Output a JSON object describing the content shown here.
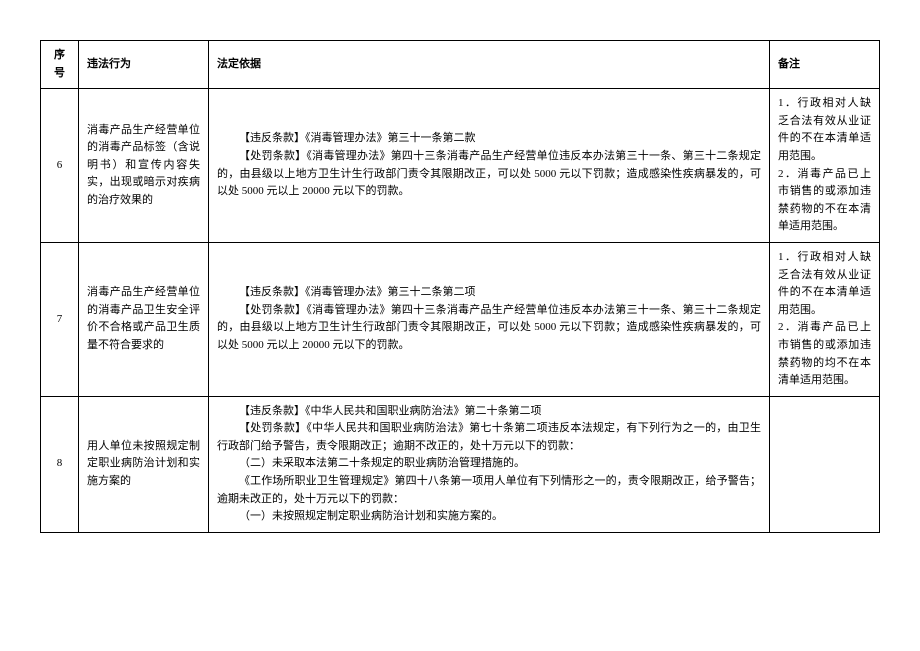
{
  "headers": {
    "num": "序号",
    "action": "违法行为",
    "basis": "法定依据",
    "note": "备注"
  },
  "rows": [
    {
      "num": "6",
      "action": "消毒产品生产经营单位的消毒产品标签（含说明书）和宣传内容失实，出现或暗示对疾病的治疗效果的",
      "basis_lines": [
        "【违反条款】《消毒管理办法》第三十一条第二款",
        "【处罚条款】《消毒管理办法》第四十三条消毒产品生产经营单位违反本办法第三十一条、第三十二条规定的，由县级以上地方卫生计生行政部门责令其限期改正，可以处 5000 元以下罚款；造成感染性疾病暴发的，可以处 5000 元以上 20000 元以下的罚款。"
      ],
      "note_items": [
        {
          "label": "1",
          "text": "．行政相对人缺乏合法有效从业证件的不在本清单适用范围。"
        },
        {
          "label": "2",
          "text": "．消毒产品已上市销售的或添加违禁药物的不在本清单适用范围。"
        }
      ]
    },
    {
      "num": "7",
      "action": "消毒产品生产经营单位的消毒产品卫生安全评价不合格或产品卫生质量不符合要求的",
      "basis_lines": [
        "【违反条款】《消毒管理办法》第三十二条第二项",
        "【处罚条款】《消毒管理办法》第四十三条消毒产品生产经营单位违反本办法第三十一条、第三十二条规定的，由县级以上地方卫生计生行政部门责令其限期改正，可以处 5000 元以下罚款；造成感染性疾病暴发的，可以处 5000 元以上 20000 元以下的罚款。"
      ],
      "note_items": [
        {
          "label": "1",
          "text": "．行政相对人缺乏合法有效从业证件的不在本清单适用范围。"
        },
        {
          "label": "2",
          "text": "．消毒产品已上市销售的或添加违禁药物的均不在本清单适用范围。"
        }
      ]
    },
    {
      "num": "8",
      "action": "用人单位未按照规定制定职业病防治计划和实施方案的",
      "basis_lines": [
        "【违反条款】《中华人民共和国职业病防治法》第二十条第二项",
        "【处罚条款】《中华人民共和国职业病防治法》第七十条第二项违反本法规定，有下列行为之一的，由卫生行政部门给予警告，责令限期改正；逾期不改正的，处十万元以下的罚款：",
        "（二）未采取本法第二十条规定的职业病防治管理措施的。",
        "《工作场所职业卫生管理规定》第四十八条第一项用人单位有下列情形之一的，责令限期改正，给予警告；逾期未改正的，处十万元以下的罚款：",
        "（一）未按照规定制定职业病防治计划和实施方案的。"
      ],
      "note_items": []
    }
  ]
}
